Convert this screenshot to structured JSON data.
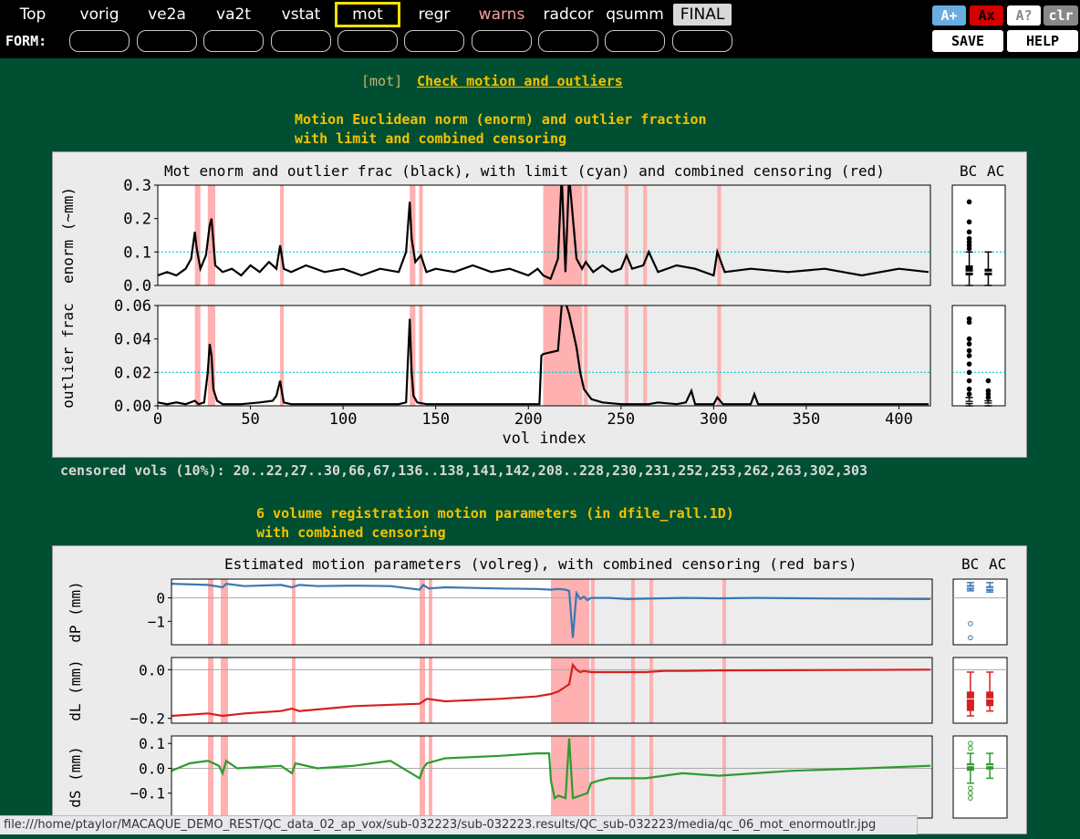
{
  "nav": {
    "tabs": [
      {
        "label": "Top",
        "key": "top"
      },
      {
        "label": "vorig",
        "key": "vorig"
      },
      {
        "label": "ve2a",
        "key": "ve2a"
      },
      {
        "label": "va2t",
        "key": "va2t"
      },
      {
        "label": "vstat",
        "key": "vstat"
      },
      {
        "label": "mot",
        "key": "mot",
        "active": true
      },
      {
        "label": "regr",
        "key": "regr"
      },
      {
        "label": "warns",
        "key": "warns"
      },
      {
        "label": "radcor",
        "key": "radcor"
      },
      {
        "label": "qsumm",
        "key": "qsumm"
      },
      {
        "label": "FINAL",
        "key": "final"
      }
    ],
    "form_label": "FORM:",
    "text_buttons": {
      "a_plus": "A+",
      "a_x": "Ax",
      "a_q": "A?",
      "clr": "clr"
    },
    "save_label": "SAVE",
    "help_label": "HELP",
    "colors": {
      "warn_tab": "#f3a0a0",
      "active_border": "#ffe000",
      "ax_bg": "#d40000",
      "aplus_bg": "#6aaee0"
    }
  },
  "section": {
    "tag": "[mot]",
    "title": "Check motion and outliers"
  },
  "figure1": {
    "caption_line1": "Motion Euclidean norm (enorm) and outlier fraction",
    "caption_line2": "with limit and combined censoring",
    "title": "Mot enorm and outlier frac (black), with limit (cyan) and combined censoring (red)",
    "bc_label": "BC",
    "ac_label": "AC",
    "censored_text": "censored vols (10%): 20..22,27..30,66,67,136..138,141,142,208..228,230,231,252,253,262,263,302,303"
  },
  "figure2": {
    "caption_line1": "6 volume registration motion parameters (in dfile_rall.1D)",
    "caption_line2": "with combined censoring",
    "title": "Estimated motion parameters (volreg), with combined censoring (red bars)",
    "bc_label": "BC",
    "ac_label": "AC"
  },
  "statusbar": {
    "url": "file:///home/ptaylor/MACAQUE_DEMO_REST/QC_data_02_ap_vox/sub-032223/sub-032223.results/QC_sub-032223/media/qc_06_mot_enormoutlr.jpg"
  },
  "chart_data": [
    {
      "type": "line",
      "name": "enorm",
      "ylabel": "enorm (~mm)",
      "ylim": [
        0,
        0.3
      ],
      "yticks": [
        "0.0",
        "0.1",
        "0.2",
        "0.3"
      ],
      "xlim": [
        0,
        417
      ],
      "limit": 0.1,
      "limit_color": "#00cccc",
      "line_color": "#000000",
      "x": [
        0,
        5,
        10,
        15,
        18,
        20,
        21,
        23,
        26,
        28,
        29,
        31,
        35,
        40,
        45,
        50,
        55,
        60,
        64,
        66,
        68,
        72,
        80,
        90,
        100,
        110,
        120,
        130,
        134,
        136,
        137,
        139,
        142,
        145,
        150,
        160,
        170,
        180,
        190,
        200,
        205,
        208,
        212,
        214,
        216,
        218,
        220,
        222,
        226,
        229,
        231,
        235,
        240,
        245,
        250,
        253,
        256,
        262,
        265,
        270,
        280,
        290,
        300,
        302,
        306,
        320,
        340,
        360,
        380,
        400,
        416
      ],
      "y": [
        0.03,
        0.04,
        0.03,
        0.05,
        0.08,
        0.16,
        0.11,
        0.05,
        0.09,
        0.18,
        0.2,
        0.06,
        0.04,
        0.05,
        0.03,
        0.06,
        0.04,
        0.07,
        0.05,
        0.12,
        0.05,
        0.04,
        0.06,
        0.04,
        0.05,
        0.03,
        0.05,
        0.04,
        0.1,
        0.25,
        0.14,
        0.07,
        0.09,
        0.04,
        0.05,
        0.04,
        0.06,
        0.04,
        0.05,
        0.03,
        0.05,
        0.03,
        0.02,
        0.05,
        0.08,
        0.33,
        0.04,
        0.33,
        0.08,
        0.05,
        0.07,
        0.04,
        0.06,
        0.04,
        0.05,
        0.09,
        0.05,
        0.06,
        0.1,
        0.04,
        0.06,
        0.05,
        0.03,
        0.1,
        0.04,
        0.05,
        0.04,
        0.05,
        0.03,
        0.05,
        0.04
      ]
    },
    {
      "type": "line",
      "name": "outlier frac",
      "ylabel": "outlier frac",
      "ylim": [
        0,
        0.06
      ],
      "yticks": [
        "0.00",
        "0.02",
        "0.04",
        "0.06"
      ],
      "xlim": [
        0,
        417
      ],
      "xticks": [
        0,
        50,
        100,
        150,
        200,
        250,
        300,
        350,
        400
      ],
      "xlabel": "vol index",
      "limit": 0.02,
      "limit_color": "#00cccc",
      "line_color": "#000000",
      "x": [
        0,
        5,
        10,
        15,
        20,
        22,
        25,
        27,
        28,
        29,
        30,
        32,
        35,
        45,
        55,
        62,
        64,
        66,
        67,
        68,
        72,
        90,
        110,
        130,
        134,
        136,
        137,
        138,
        140,
        145,
        160,
        180,
        200,
        206,
        207,
        208,
        212,
        216,
        218,
        220,
        222,
        224,
        226,
        228,
        230,
        234,
        240,
        250,
        260,
        265,
        270,
        280,
        285,
        288,
        290,
        300,
        302,
        305,
        320,
        322,
        324,
        340,
        380,
        416
      ],
      "y": [
        0.002,
        0.001,
        0.002,
        0.001,
        0.003,
        0.001,
        0.002,
        0.02,
        0.037,
        0.03,
        0.01,
        0.003,
        0.001,
        0.001,
        0.002,
        0.003,
        0.006,
        0.015,
        0.008,
        0.002,
        0.001,
        0.001,
        0.001,
        0.001,
        0.002,
        0.052,
        0.02,
        0.006,
        0.002,
        0.001,
        0.001,
        0.001,
        0.001,
        0.001,
        0.03,
        0.031,
        0.032,
        0.033,
        0.06,
        0.062,
        0.055,
        0.045,
        0.035,
        0.02,
        0.01,
        0.004,
        0.002,
        0.001,
        0.001,
        0.001,
        0.002,
        0.001,
        0.002,
        0.009,
        0.001,
        0.001,
        0.005,
        0.001,
        0.001,
        0.007,
        0.001,
        0.001,
        0.001,
        0.001
      ]
    },
    {
      "type": "line",
      "name": "dP",
      "ylabel": "dP (mm)",
      "ylim": [
        -2,
        0.8
      ],
      "yticks": [
        "0",
        "−1"
      ],
      "xlim": [
        0,
        417
      ],
      "line_color": "#3a78b2",
      "x": [
        0,
        20,
        28,
        30,
        40,
        60,
        66,
        70,
        80,
        100,
        120,
        136,
        138,
        141,
        150,
        180,
        200,
        208,
        212,
        216,
        218,
        220,
        222,
        224,
        226,
        228,
        230,
        240,
        250,
        280,
        300,
        320,
        360,
        416
      ],
      "y": [
        0.6,
        0.55,
        0.45,
        0.6,
        0.5,
        0.55,
        0.45,
        0.55,
        0.5,
        0.52,
        0.5,
        0.35,
        0.55,
        0.4,
        0.45,
        0.4,
        0.38,
        0.35,
        0.38,
        0.35,
        0.3,
        -1.7,
        0.2,
        -0.05,
        0.05,
        -0.1,
        0.0,
        0.0,
        -0.05,
        0.0,
        -0.02,
        0.0,
        -0.03,
        -0.05
      ]
    },
    {
      "type": "line",
      "name": "dL",
      "ylabel": "dL (mm)",
      "ylim": [
        -0.22,
        0.05
      ],
      "yticks": [
        "0.0",
        "−0.2"
      ],
      "xlim": [
        0,
        417
      ],
      "line_color": "#d62020",
      "x": [
        0,
        20,
        28,
        40,
        60,
        66,
        70,
        100,
        136,
        140,
        150,
        180,
        200,
        208,
        212,
        216,
        218,
        220,
        222,
        224,
        226,
        230,
        240,
        260,
        270,
        280,
        300,
        340,
        416
      ],
      "y": [
        -0.19,
        -0.18,
        -0.19,
        -0.18,
        -0.17,
        -0.16,
        -0.17,
        -0.15,
        -0.14,
        -0.12,
        -0.13,
        -0.12,
        -0.11,
        -0.1,
        -0.09,
        -0.07,
        -0.06,
        0.02,
        0.0,
        -0.01,
        -0.005,
        -0.01,
        -0.01,
        -0.01,
        -0.005,
        -0.005,
        -0.003,
        -0.002,
        0.0
      ]
    },
    {
      "type": "line",
      "name": "dS",
      "ylabel": "dS (mm)",
      "ylim": [
        -0.2,
        0.13
      ],
      "yticks": [
        "0.1",
        "0.0",
        "−0.1"
      ],
      "xlim": [
        0,
        417
      ],
      "line_color": "#2e9a2e",
      "x": [
        0,
        10,
        20,
        26,
        28,
        30,
        36,
        60,
        66,
        68,
        80,
        100,
        120,
        136,
        138,
        140,
        150,
        180,
        200,
        207,
        208,
        210,
        212,
        216,
        218,
        220,
        224,
        228,
        230,
        234,
        240,
        260,
        280,
        300,
        340,
        380,
        416
      ],
      "y": [
        -0.01,
        0.02,
        0.03,
        0.01,
        -0.02,
        0.03,
        0.0,
        0.01,
        -0.02,
        0.02,
        0.0,
        0.01,
        0.03,
        -0.04,
        0.0,
        0.02,
        0.04,
        0.05,
        0.06,
        0.06,
        -0.05,
        -0.12,
        -0.11,
        -0.12,
        0.12,
        -0.12,
        -0.11,
        -0.1,
        -0.06,
        -0.05,
        -0.04,
        -0.04,
        -0.02,
        -0.03,
        -0.01,
        0.0,
        0.01
      ]
    }
  ],
  "censor_ranges": [
    [
      20,
      22
    ],
    [
      27,
      30
    ],
    [
      66,
      67
    ],
    [
      136,
      138
    ],
    [
      141,
      142
    ],
    [
      208,
      228
    ],
    [
      230,
      231
    ],
    [
      252,
      253
    ],
    [
      262,
      263
    ],
    [
      302,
      303
    ]
  ],
  "censor_color": "#ffb0b0",
  "post_censor_shade": {
    "from": 208,
    "to": 417,
    "color": "#ececec"
  }
}
